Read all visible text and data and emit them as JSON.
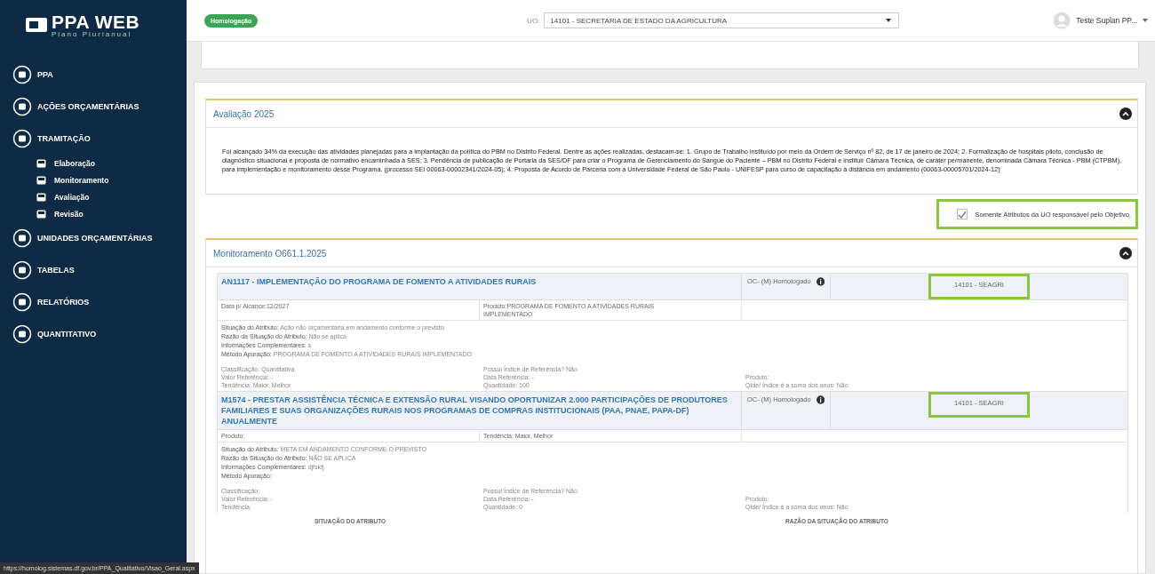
{
  "logo": {
    "title": "PPA WEB",
    "subtitle": "Plano Plurianual"
  },
  "sidebar": {
    "items": [
      {
        "label": "PPA"
      },
      {
        "label": "AÇÕES ORÇAMENTÁRIAS"
      },
      {
        "label": "TRAMITAÇÃO",
        "children": [
          {
            "label": "Elaboração"
          },
          {
            "label": "Monitoramento"
          },
          {
            "label": "Avaliação"
          },
          {
            "label": "Revisão"
          }
        ]
      },
      {
        "label": "UNIDADES ORÇAMENTÁRIAS"
      },
      {
        "label": "TABELAS"
      },
      {
        "label": "RELATÓRIOS"
      },
      {
        "label": "QUANTITATIVO"
      }
    ]
  },
  "topbar": {
    "environment_badge": "Homologação",
    "uo_label": "UO:",
    "uo_value": "14101 - SECRETARIA DE ESTADO DA AGRICULTURA",
    "user": "Teste Suplan PP..."
  },
  "evaluation": {
    "title": "Avaliação 2025",
    "expanded": true,
    "text": "Foi alcançado 34% da execução das atividades planejadas para a implantação da política do PBM no Distrito Federal. Dentre as ações realizadas, destacam-se: 1. Grupo de Trabalho instituído por meio da Ordem de Serviço nº 82, de 17 de janeiro de 2024; 2. Formalização de hospitais piloto, conclusão de diagnóstico situacional e proposta de normativo encaminhada à SES; 3. Pendência de publicação de Portaria da SES/DF para criar o Programa de Gerenciamento do Sangue do Paciente – PBM no Distrito Federal e instituir Câmara Técnica, de caráter permanente, denominada Câmara Técnica - PBM (CTPBM), para implementação e monitoramento desse Programa. (processo SEI 00063-00002341/2024-05); 4. Proposta de Acordo de Parceria com a Universidade Federal de São Paulo - UNIFESP para curso de capacitação à distância em andamento (00063-00005701/2024-12)"
  },
  "filter": {
    "label": "Somente Atributos da UO responsável pelo Objetivo.",
    "checked": true,
    "highlighted": true
  },
  "monitoring": {
    "title": "Monitoramento O661.1.2025",
    "expanded": true,
    "attributes": [
      {
        "title": "AN1117 - IMPLEMENTAÇÃO DO PROGRAMA DE FOMENTO A ATIVIDADES RURAIS",
        "status": "OC- (M) Homologado",
        "uo": "14101 - SEAGRI",
        "uo_highlighted": true,
        "info": [
          "Data p/ Alcance:12/2027",
          "Produto:PROGRAMA DE FOMENTO A ATIVIDADES RURAIS IMPLEMENTADO"
        ],
        "details": [
          "**Situação do Atributo:** Ação não orçamentária em andamento conforme o previsto",
          "**Razão da Situação do Atributo:** Não se aplica",
          "**Informações Complementares:** s",
          "**Método Apuração:** PROGRAMA DE FOMENTO A ATIVIDADES RURAIS IMPLEMENTADO"
        ],
        "fields": [
          [
            "Classificação: Quantitativa",
            "Valor Referência: -",
            "Tendência: Maior, Melhor"
          ],
          [
            "Possui Índice de Referência? Não",
            "Data Referência: -",
            "Quantidade: 100"
          ],
          [
            "Produto:",
            "Qtde/ Índice é a soma dos anos: Não"
          ]
        ]
      },
      {
        "title": "M1574 - PRESTAR ASSISTÊNCIA TÉCNICA E EXTENSÃO RURAL VISANDO OPORTUNIZAR 2.000 PARTICIPAÇÕES DE PRODUTORES FAMILIARES E SUAS ORGANIZAÇÕES RURAIS NOS PROGRAMAS DE COMPRAS INSTITUCIONAIS (PAA, PNAE, PAPA-DF) ANUALMENTE",
        "status": "OC- (M) Homologado",
        "uo": "14101 - SEAGRI",
        "uo_highlighted": true,
        "info": [
          "Produto:",
          "Tendência: Maior, Melhor"
        ],
        "details": [
          "**Situação do Atributo:** META EM ANDAMENTO CONFORME O PREVISTO",
          "**Razão da Situação do Atributo:** NÃO SE APLICA",
          "**Informações Complementares:** djfskfj",
          "**Método Apuração:**"
        ],
        "fields": [
          [
            "Classificação:",
            "Valor Referência: -",
            "Tendência:"
          ],
          [
            "Possui Índice de Referência? Não",
            "Data Referência: -",
            "Quantidade: 0"
          ],
          [
            "Produto:",
            "Qtde/ Índice é a soma dos anos: Não"
          ]
        ]
      }
    ],
    "table_columns": [
      "SITUAÇÃO DO ATRIBUTO",
      "RAZÃO DA SITUAÇÃO DO ATRIBUTO"
    ]
  },
  "status_bar": {
    "link": "https://homolog.sistemas.df.gov.br/PPA_Qualitativo/Visao_Geral.aspx"
  }
}
